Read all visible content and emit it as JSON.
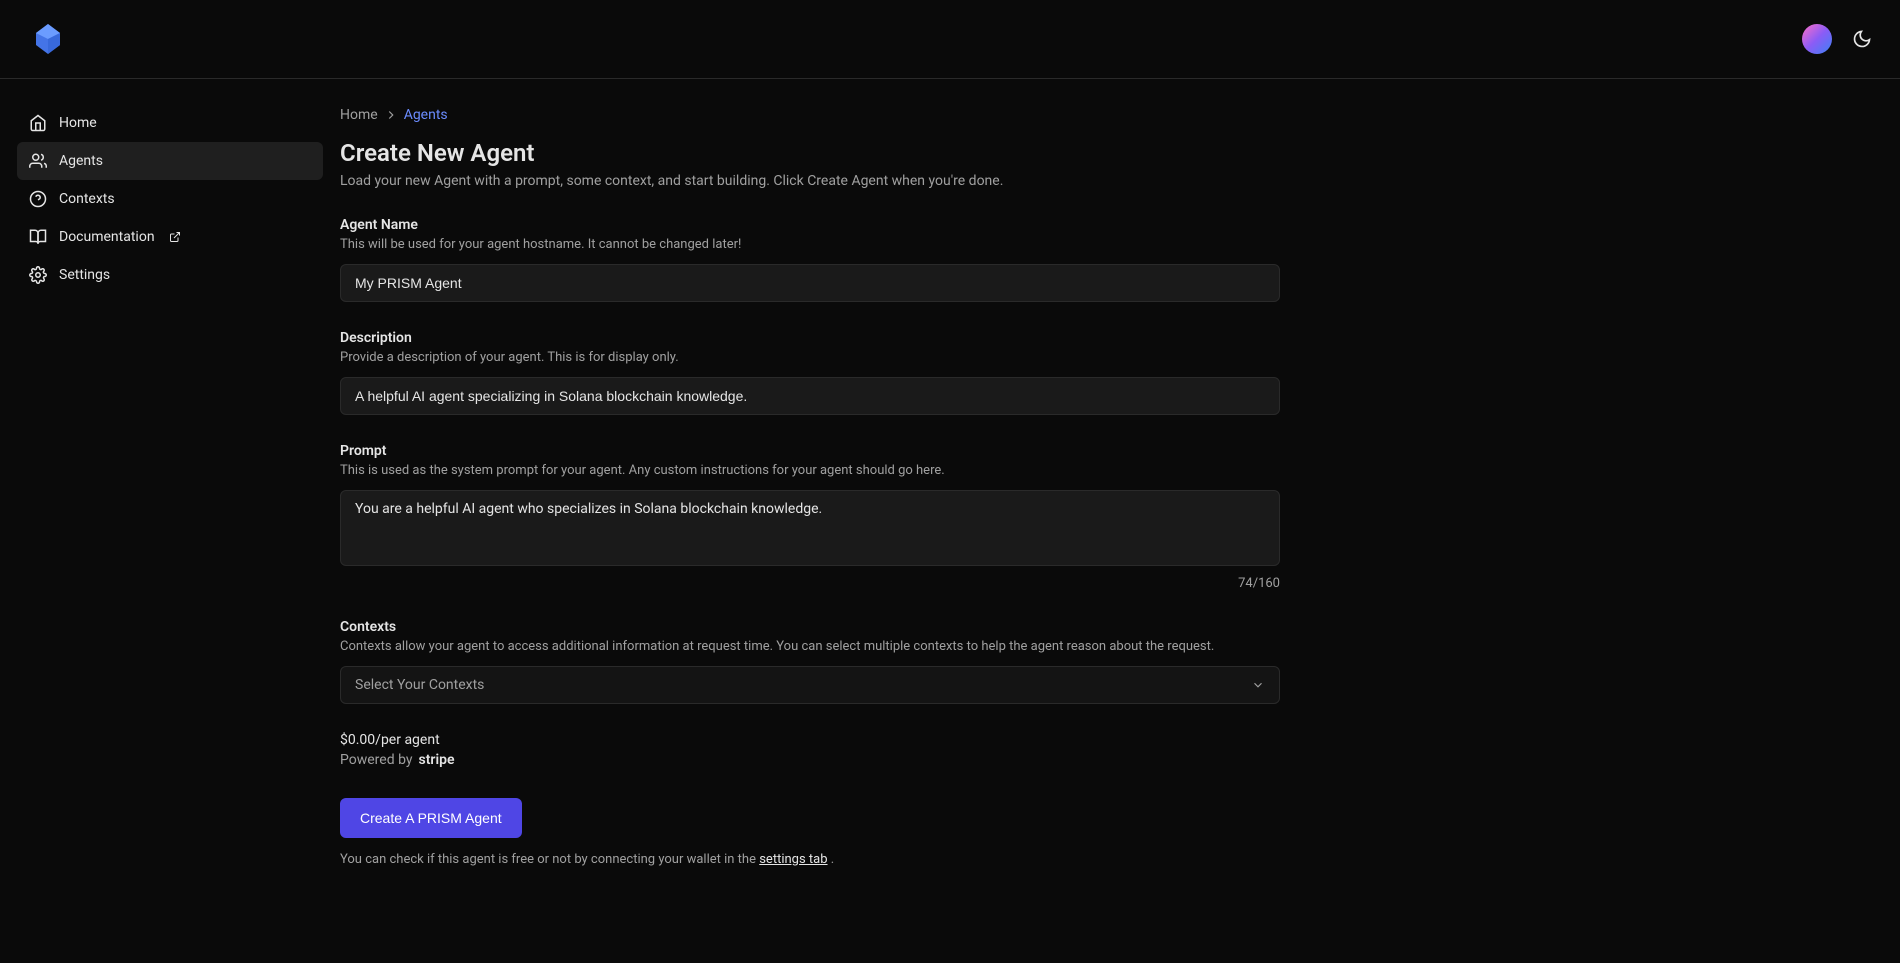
{
  "header": {
    "theme_icon": "moon"
  },
  "sidebar": {
    "items": [
      {
        "label": "Home",
        "icon": "home"
      },
      {
        "label": "Agents",
        "icon": "users",
        "active": true
      },
      {
        "label": "Contexts",
        "icon": "help-circle"
      },
      {
        "label": "Documentation",
        "icon": "book",
        "external": true
      },
      {
        "label": "Settings",
        "icon": "gear"
      }
    ]
  },
  "breadcrumb": {
    "home": "Home",
    "agents": "Agents"
  },
  "page": {
    "title": "Create New Agent",
    "subtitle": "Load your new Agent with a prompt, some context, and start building. Click Create Agent when you're done."
  },
  "form": {
    "agent_name": {
      "label": "Agent Name",
      "help": "This will be used for your agent hostname. It cannot be changed later!",
      "value": "My PRISM Agent"
    },
    "description": {
      "label": "Description",
      "help": "Provide a description of your agent. This is for display only.",
      "value": "A helpful AI agent specializing in Solana blockchain knowledge."
    },
    "prompt": {
      "label": "Prompt",
      "help": "This is used as the system prompt for your agent. Any custom instructions for your agent should go here.",
      "value": "You are a helpful AI agent who specializes in Solana blockchain knowledge.",
      "char_count": "74/160"
    },
    "contexts": {
      "label": "Contexts",
      "help": "Contexts allow your agent to access additional information at request time. You can select multiple contexts to help the agent reason about the request.",
      "placeholder": "Select Your Contexts"
    }
  },
  "pricing": {
    "price": "$0.00/per agent",
    "powered_by": "Powered by",
    "provider": "stripe"
  },
  "actions": {
    "create_button": "Create A PRISM Agent"
  },
  "footer": {
    "text_prefix": "You can check if this agent is free or not by connecting your wallet in the ",
    "link_text": "settings tab",
    "text_suffix": " ."
  }
}
